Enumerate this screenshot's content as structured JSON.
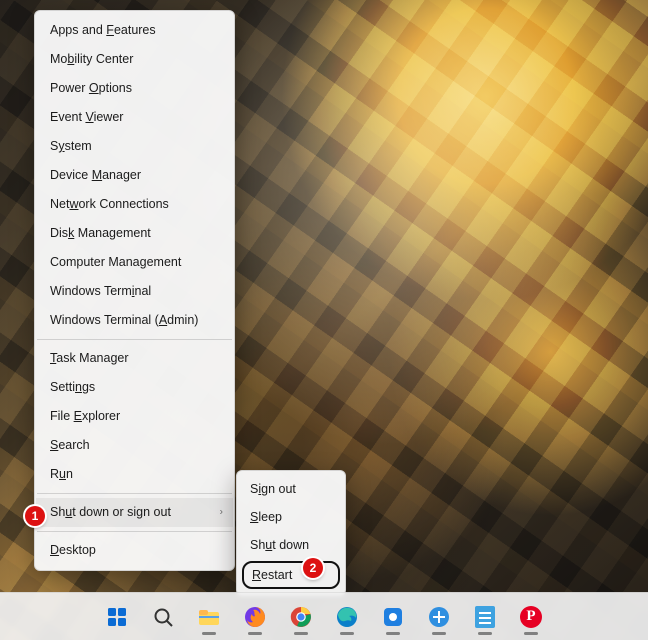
{
  "winx_menu": {
    "groups": [
      [
        {
          "id": "apps-features",
          "pre": "Apps and ",
          "mn": "F",
          "post": "eatures"
        },
        {
          "id": "mobility-center",
          "pre": "Mo",
          "mn": "b",
          "post": "ility Center"
        },
        {
          "id": "power-options",
          "pre": "Power ",
          "mn": "O",
          "post": "ptions"
        },
        {
          "id": "event-viewer",
          "pre": "Event ",
          "mn": "V",
          "post": "iewer"
        },
        {
          "id": "system",
          "pre": "S",
          "mn": "y",
          "post": "stem"
        },
        {
          "id": "device-manager",
          "pre": "Device ",
          "mn": "M",
          "post": "anager"
        },
        {
          "id": "network-connections",
          "pre": "Net",
          "mn": "w",
          "post": "ork Connections"
        },
        {
          "id": "disk-management",
          "pre": "Dis",
          "mn": "k",
          "post": " Management"
        },
        {
          "id": "computer-management",
          "pre": "Computer Mana",
          "mn": "g",
          "post": "ement"
        },
        {
          "id": "windows-terminal",
          "pre": "Windows Term",
          "mn": "i",
          "post": "nal"
        },
        {
          "id": "windows-terminal-admin",
          "pre": "Windows Terminal (",
          "mn": "A",
          "post": "dmin)"
        }
      ],
      [
        {
          "id": "task-manager",
          "pre": "",
          "mn": "T",
          "post": "ask Manager"
        },
        {
          "id": "settings",
          "pre": "Setti",
          "mn": "n",
          "post": "gs"
        },
        {
          "id": "file-explorer",
          "pre": "File ",
          "mn": "E",
          "post": "xplorer"
        },
        {
          "id": "search",
          "pre": "",
          "mn": "S",
          "post": "earch"
        },
        {
          "id": "run",
          "pre": "R",
          "mn": "u",
          "post": "n"
        }
      ],
      [
        {
          "id": "shutdown-signout",
          "pre": "Sh",
          "mn": "u",
          "post": "t down or sign out",
          "submenu": true,
          "hover": true
        }
      ],
      [
        {
          "id": "desktop",
          "pre": "",
          "mn": "D",
          "post": "esktop"
        }
      ]
    ]
  },
  "submenu": {
    "items": [
      {
        "id": "sign-out",
        "pre": "S",
        "mn": "i",
        "post": "gn out"
      },
      {
        "id": "sleep",
        "pre": "",
        "mn": "S",
        "post": "leep"
      },
      {
        "id": "shut-down",
        "pre": "Sh",
        "mn": "u",
        "post": "t down"
      },
      {
        "id": "restart",
        "pre": "",
        "mn": "R",
        "post": "estart",
        "outlined": true
      }
    ]
  },
  "callouts": {
    "one": "1",
    "two": "2"
  },
  "taskbar": {
    "buttons": [
      {
        "id": "start",
        "name": "start-icon",
        "type": "start"
      },
      {
        "id": "search",
        "name": "search-icon",
        "type": "search"
      },
      {
        "id": "explorer",
        "name": "file-explorer-icon",
        "type": "explorer",
        "running": true
      },
      {
        "id": "firefox",
        "name": "firefox-icon",
        "type": "firefox",
        "running": true
      },
      {
        "id": "chrome",
        "name": "chrome-icon",
        "type": "chrome",
        "running": true
      },
      {
        "id": "edge",
        "name": "edge-icon",
        "type": "edge",
        "running": true
      },
      {
        "id": "bluesquare",
        "name": "app-icon",
        "type": "bluesquare",
        "running": true
      },
      {
        "id": "pluscircle",
        "name": "app-icon",
        "type": "pluscircle",
        "running": true
      },
      {
        "id": "notes",
        "name": "notes-icon",
        "type": "notes",
        "running": true
      },
      {
        "id": "pinterest",
        "name": "pinterest-icon",
        "type": "pinterest",
        "running": true
      }
    ]
  }
}
